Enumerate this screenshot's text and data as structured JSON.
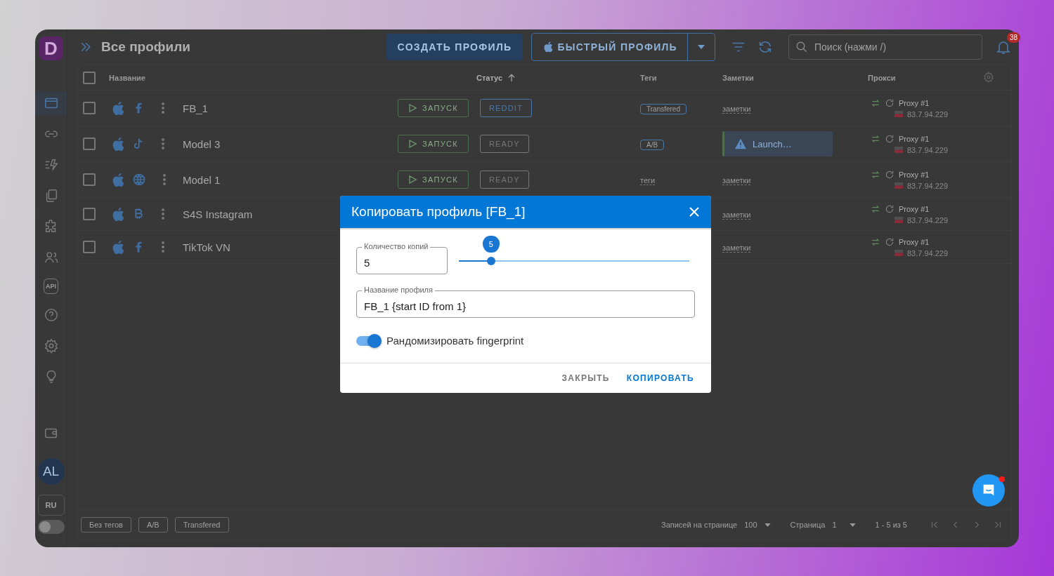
{
  "app": {
    "logo": "D",
    "title": "Все профили"
  },
  "sidebar": {
    "items": [
      {
        "kind": "browser",
        "selected": true
      },
      {
        "kind": "link",
        "selected": false
      },
      {
        "kind": "automation",
        "selected": false
      },
      {
        "kind": "copy",
        "selected": false
      },
      {
        "kind": "extension",
        "selected": false
      },
      {
        "kind": "team",
        "selected": false
      },
      {
        "kind": "api",
        "label": "API",
        "selected": false
      },
      {
        "kind": "help",
        "selected": false
      },
      {
        "kind": "settings",
        "selected": false
      },
      {
        "kind": "idea",
        "selected": false
      }
    ],
    "avatar": "AL",
    "language": "RU",
    "theme_toggle": {
      "on": false
    }
  },
  "toolbar": {
    "create_button": "СОЗДАТЬ ПРОФИЛЬ",
    "quick_button": "БЫСТРЫЙ ПРОФИЛЬ",
    "search": {
      "placeholder": "Поиск (нажми /)"
    },
    "notifications": "38"
  },
  "table": {
    "all_selected": false,
    "columns": [
      {
        "label": "Название",
        "sorted": false
      },
      {
        "label": "Статус",
        "sorted": true
      },
      {
        "label": "Теги",
        "sorted": false
      },
      {
        "label": "Заметки",
        "sorted": false
      },
      {
        "label": "Прокси",
        "sorted": false
      }
    ],
    "rows": [
      {
        "selected": false,
        "name": "FB_1",
        "icons": [
          {
            "kind": "apple"
          },
          {
            "kind": "facebook"
          }
        ],
        "launch": "ЗАПУСК",
        "status": {
          "label": "REDDIT",
          "color": "#4a78aa"
        },
        "tag": {
          "kind": "badge",
          "text": "Transfered"
        },
        "note": {
          "kind": "link",
          "text": "заметки"
        },
        "proxy": {
          "name": "Proxy #1",
          "ip": "83.7.94.229"
        }
      },
      {
        "selected": false,
        "name": "Model 3",
        "icons": [
          {
            "kind": "apple"
          },
          {
            "kind": "tiktok"
          }
        ],
        "launch": "ЗАПУСК",
        "status": {
          "label": "READY",
          "color": "#777777"
        },
        "tag": {
          "kind": "badge",
          "text": "A/B"
        },
        "note": {
          "kind": "warning",
          "text": "Launch…"
        },
        "proxy": {
          "name": "Proxy #1",
          "ip": "83.7.94.229"
        }
      },
      {
        "selected": false,
        "name": "Model 1",
        "icons": [
          {
            "kind": "apple"
          },
          {
            "kind": "web"
          }
        ],
        "launch": "ЗАПУСК",
        "status": {
          "label": "READY",
          "color": "#777777"
        },
        "tag": {
          "kind": "placeholder",
          "text": "теги"
        },
        "note": {
          "kind": "link",
          "text": "заметки"
        },
        "proxy": {
          "name": "Proxy #1",
          "ip": "83.7.94.229"
        }
      },
      {
        "selected": false,
        "name": "S4S Instagram",
        "icons": [
          {
            "kind": "apple"
          },
          {
            "kind": "bitcoin"
          }
        ],
        "note": {
          "kind": "link",
          "text": "заметки"
        },
        "proxy": {
          "name": "Proxy #1",
          "ip": "83.7.94.229"
        }
      },
      {
        "selected": false,
        "name": "TikTok VN",
        "icons": [
          {
            "kind": "apple"
          },
          {
            "kind": "facebook"
          }
        ],
        "note": {
          "kind": "link",
          "text": "заметки"
        },
        "proxy": {
          "name": "Proxy #1",
          "ip": "83.7.94.229"
        }
      }
    ]
  },
  "footer": {
    "tag_filters": [
      "Без тегов",
      "A/B",
      "Transfered"
    ],
    "rows_per_page_label": "Записей на странице",
    "rows_per_page": "100",
    "page_label": "Страница",
    "page": "1",
    "range": "1 - 5 из 5"
  },
  "dialog": {
    "title": "Копировать профиль [FB_1]",
    "copies": {
      "label": "Количество копий",
      "value": "5"
    },
    "slider": {
      "level": 0.14,
      "value_label": "5"
    },
    "name_field": {
      "label": "Название профиля",
      "value": "FB_1 {start ID from 1}"
    },
    "randomize": {
      "label": "Рандомизировать fingerprint",
      "on": true
    },
    "buttons": [
      {
        "label": "ЗАКРЫТЬ",
        "kind": "text"
      },
      {
        "label": "КОПИРОВАТЬ",
        "kind": "primary"
      }
    ]
  }
}
